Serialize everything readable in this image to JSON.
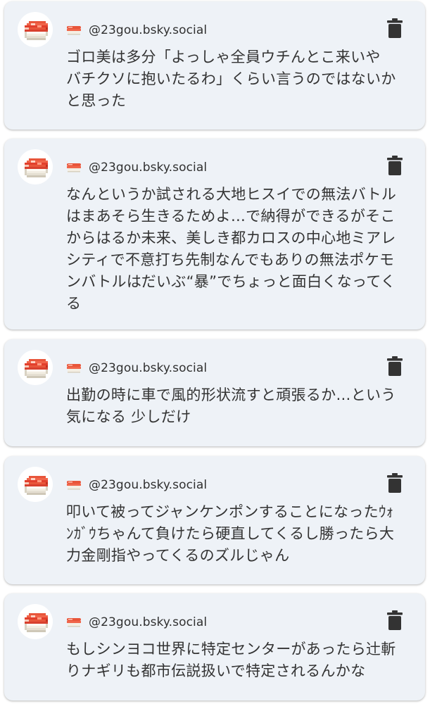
{
  "colors": {
    "card_background": "#eef2f7",
    "page_background": "#ffffff",
    "text": "#333333",
    "icon": "#333333"
  },
  "icons": {
    "avatar": "sushi-avatar-icon",
    "handle_prefix": "sushi-icon",
    "delete": "trash-icon"
  },
  "posts": [
    {
      "handle": "@23gou.bsky.social",
      "text": "ゴロ美は多分「よっしゃ全員ウチんとこ来いや\nバチクソに抱いたるわ」くらい言うのではないか\nと思った"
    },
    {
      "handle": "@23gou.bsky.social",
      "text": "なんというか試される大地ヒスイでの無法バトル\nはまあそら生きるためよ…で納得ができるがそこ\nからはるか未来、美しき都カロスの中心地ミアレ\nシティで不意打ち先制なんでもありの無法ポケモ\nンバトルはだいぶ“暴”でちょっと面白くなってく\nる"
    },
    {
      "handle": "@23gou.bsky.social",
      "text": "出勤の時に車で風的形状流すと頑張るか…という\n気になる 少しだけ"
    },
    {
      "handle": "@23gou.bsky.social",
      "text": "叩いて被ってジャンケンポンすることになったｳｫ\nﾝｶﾞｳちゃんて負けたら硬直してくるし勝ったら大\n力金剛指やってくるのズルじゃん"
    },
    {
      "handle": "@23gou.bsky.social",
      "text": "もしシンヨコ世界に特定センターがあったら辻斬\nりナギリも都市伝説扱いで特定されるんかな"
    }
  ]
}
